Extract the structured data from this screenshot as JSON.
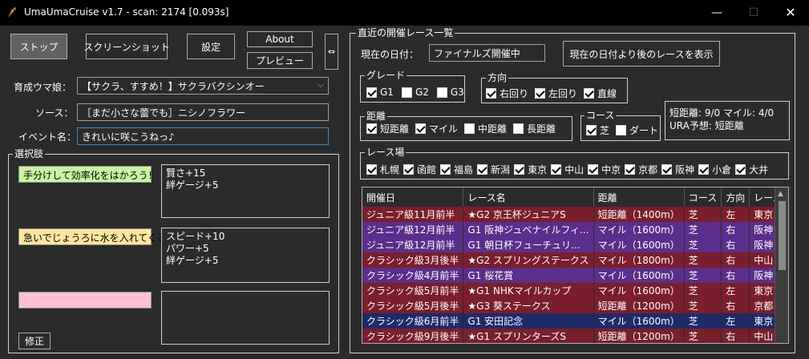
{
  "window": {
    "title": "UmaUmaCruise v1.7 - scan: 2174 [0.093s]",
    "minimize": "—",
    "maximize": "☐",
    "close": "✕"
  },
  "toolbar": {
    "stop": "ストップ",
    "screenshot": "スクリーンショット",
    "settings": "設定",
    "about": "About",
    "preview": "プレビュー",
    "expand": "⇔"
  },
  "form": {
    "uma_label": "育成ウマ娘：",
    "uma_value": "【サクラ、すすめ！】サクラバクシンオー",
    "source_label": "ソース：",
    "source_value": "［まだ小さな蕾でも］ニシノフラワー",
    "event_label": "イベント名：",
    "event_value": "きれいに咲こうねっ♪"
  },
  "choices": {
    "group_label": "選択肢",
    "items": [
      {
        "label": "手分けして効率化をはかろう！",
        "effect": "賢さ+15\n絆ゲージ+5",
        "color": "#c8f5a0"
      },
      {
        "label": "急いでじょうろに水を入れてくる",
        "effect": "スピード+10\nパワー+5\n絆ゲージ+5",
        "color": "#fde7a0"
      },
      {
        "label": "",
        "effect": "",
        "color": "#ffc0d8"
      }
    ],
    "fix_button": "修正"
  },
  "races": {
    "group_label": "直近の開催レース一覧",
    "date_label": "現在の日付：",
    "date_value": "ファイナルズ開催中",
    "show_after_button": "現在の日付より後のレースを表示",
    "grade": {
      "label": "グレード",
      "options": [
        {
          "label": "G1",
          "checked": true
        },
        {
          "label": "G2",
          "checked": false
        },
        {
          "label": "G3",
          "checked": false
        }
      ]
    },
    "direction": {
      "label": "方向",
      "options": [
        {
          "label": "右回り",
          "checked": true
        },
        {
          "label": "左回り",
          "checked": true
        },
        {
          "label": "直線",
          "checked": true
        }
      ]
    },
    "distance": {
      "label": "距離",
      "options": [
        {
          "label": "短距離",
          "checked": true
        },
        {
          "label": "マイル",
          "checked": true
        },
        {
          "label": "中距離",
          "checked": false
        },
        {
          "label": "長距離",
          "checked": false
        }
      ]
    },
    "course": {
      "label": "コース",
      "options": [
        {
          "label": "芝",
          "checked": true
        },
        {
          "label": "ダート",
          "checked": false
        }
      ]
    },
    "summary": {
      "line1": "短距離: 9/0 マイル: 4/0",
      "line2": "URA予想: 短距離"
    },
    "venue": {
      "label": "レース場",
      "options": [
        {
          "label": "札幌",
          "checked": true
        },
        {
          "label": "函館",
          "checked": true
        },
        {
          "label": "福島",
          "checked": true
        },
        {
          "label": "新潟",
          "checked": true
        },
        {
          "label": "東京",
          "checked": true
        },
        {
          "label": "中山",
          "checked": true
        },
        {
          "label": "中京",
          "checked": true
        },
        {
          "label": "京都",
          "checked": true
        },
        {
          "label": "阪神",
          "checked": true
        },
        {
          "label": "小倉",
          "checked": true
        },
        {
          "label": "大井",
          "checked": true
        }
      ]
    },
    "columns": [
      "開催日",
      "レース名",
      "距離",
      "コース",
      "方向",
      "レース場"
    ],
    "rows": [
      {
        "date": "ジュニア級11月前半",
        "name": "★G2 京王杯ジュニアS",
        "distance": "短距離（1400m）",
        "course": "芝",
        "dir": "左",
        "venue": "東京",
        "grade": "g2"
      },
      {
        "date": "ジュニア級12月前半",
        "name": "G1 阪神ジュベナイルフィ...",
        "distance": "マイル（1600m）",
        "course": "芝",
        "dir": "右",
        "venue": "阪神",
        "grade": "g1"
      },
      {
        "date": "ジュニア級12月前半",
        "name": "G1 朝日杯フューチュリ...",
        "distance": "マイル（1600m）",
        "course": "芝",
        "dir": "右",
        "venue": "阪神",
        "grade": "g1"
      },
      {
        "date": "クラシック級3月後半",
        "name": "★G2 スプリングステークス",
        "distance": "マイル（1800m）",
        "course": "芝",
        "dir": "右",
        "venue": "中山",
        "grade": "g2"
      },
      {
        "date": "クラシック級4月前半",
        "name": "G1 桜花賞",
        "distance": "マイル（1600m）",
        "course": "芝",
        "dir": "右",
        "venue": "阪神",
        "grade": "g1"
      },
      {
        "date": "クラシック級5月前半",
        "name": "★G1 NHKマイルカップ",
        "distance": "マイル（1600m）",
        "course": "芝",
        "dir": "左",
        "venue": "東京",
        "grade": "g2"
      },
      {
        "date": "クラシック級5月後半",
        "name": "★G3 葵ステークス",
        "distance": "短距離（1200m）",
        "course": "芝",
        "dir": "右",
        "venue": "京都",
        "grade": "g3"
      },
      {
        "date": "クラシック級6月前半",
        "name": "G1 安田記念",
        "distance": "マイル（1600m）",
        "course": "芝",
        "dir": "左",
        "venue": "東京",
        "grade": "g1b"
      },
      {
        "date": "クラシック級9月後半",
        "name": "★G1 スプリンターズS",
        "distance": "短距離（1200m）",
        "course": "芝",
        "dir": "右",
        "venue": "中山",
        "grade": "g2"
      }
    ]
  }
}
